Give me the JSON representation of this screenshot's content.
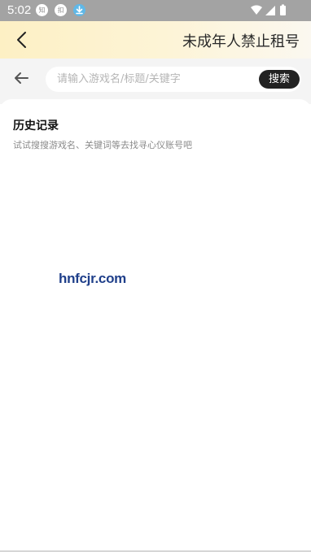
{
  "status_bar": {
    "time": "5:02",
    "notif_1": "知",
    "notif_2": "扣",
    "bg_color": "#a3a3a3"
  },
  "header": {
    "title": "未成年人禁止租号",
    "back_icon": "chevron-left-icon",
    "gradient_start": "#fdf0c4",
    "gradient_end": "#fbf8f0"
  },
  "search": {
    "back_icon": "arrow-left-icon",
    "placeholder": "请输入游戏名/标题/关键字",
    "value": "",
    "button_label": "搜索",
    "button_color": "#222222"
  },
  "history": {
    "title": "历史记录",
    "hint": "试试搜搜游戏名、关键词等去找寻心仪账号吧"
  },
  "watermark": {
    "text": "hnfcjr.com"
  }
}
